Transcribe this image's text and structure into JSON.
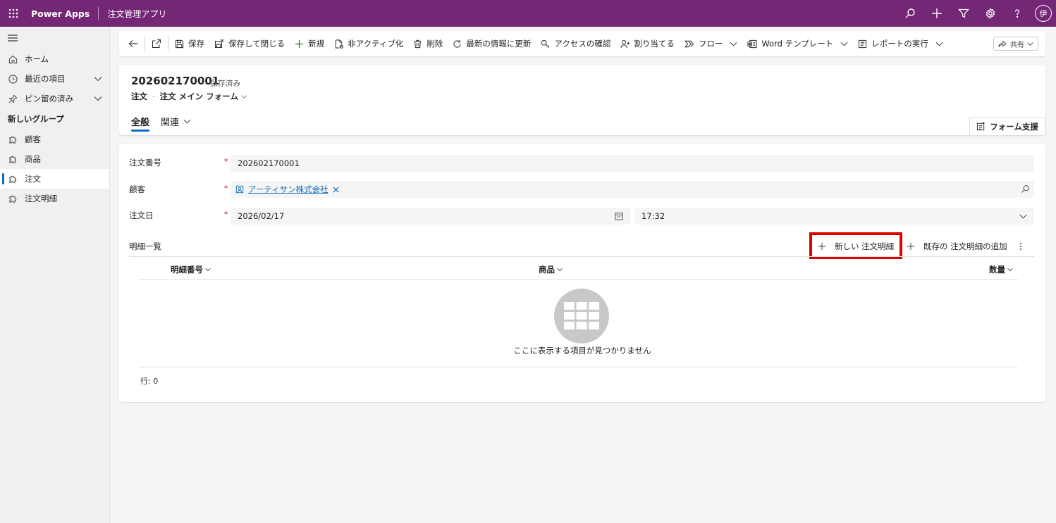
{
  "topbar": {
    "brand": "Power Apps",
    "app_name": "注文管理アプリ",
    "avatar": "伊"
  },
  "sidebar": {
    "items": [
      {
        "label": "ホーム",
        "icon": "home-icon"
      },
      {
        "label": "最近の項目",
        "icon": "clock-icon"
      },
      {
        "label": "ピン留め済み",
        "icon": "pin-icon"
      }
    ],
    "group_title": "新しいグループ",
    "entities": [
      {
        "label": "顧客",
        "icon": "puzzle-icon"
      },
      {
        "label": "商品",
        "icon": "puzzle-icon"
      },
      {
        "label": "注文",
        "icon": "puzzle-icon",
        "active": true
      },
      {
        "label": "注文明細",
        "icon": "puzzle-icon"
      }
    ]
  },
  "commands": {
    "save": "保存",
    "save_close": "保存して閉じる",
    "new": "新規",
    "deactivate": "非アクティブ化",
    "delete": "削除",
    "refresh": "最新の情報に更新",
    "check_access": "アクセスの確認",
    "assign": "割り当てる",
    "flow": "フロー",
    "word_template": "Word テンプレート",
    "run_report": "レポートの実行",
    "share": "共有"
  },
  "record": {
    "title": "202602170001",
    "status": "- 保存済み",
    "entity": "注文",
    "form_name": "注文 メイン フォーム",
    "tabs": [
      "全般",
      "関連"
    ],
    "form_assist": "フォーム支援"
  },
  "form": {
    "order_number_label": "注文番号",
    "order_number_value": "202602170001",
    "customer_label": "顧客",
    "customer_value": "アーティサン株式会社",
    "order_date_label": "注文日",
    "order_date_value": "2026/02/17",
    "order_time_value": "17:32",
    "required_mark": "*"
  },
  "subgrid": {
    "title": "明細一覧",
    "new_button": "新しい 注文明細",
    "add_existing": "既存の 注文明細の追加",
    "columns": [
      "明細番号",
      "商品",
      "数量"
    ],
    "empty_message": "ここに表示する項目が見つかりません",
    "row_count": "行: 0"
  },
  "colors": {
    "topbar": "#742774",
    "accent": "#0f6cbd",
    "highlight": "#e00000"
  }
}
